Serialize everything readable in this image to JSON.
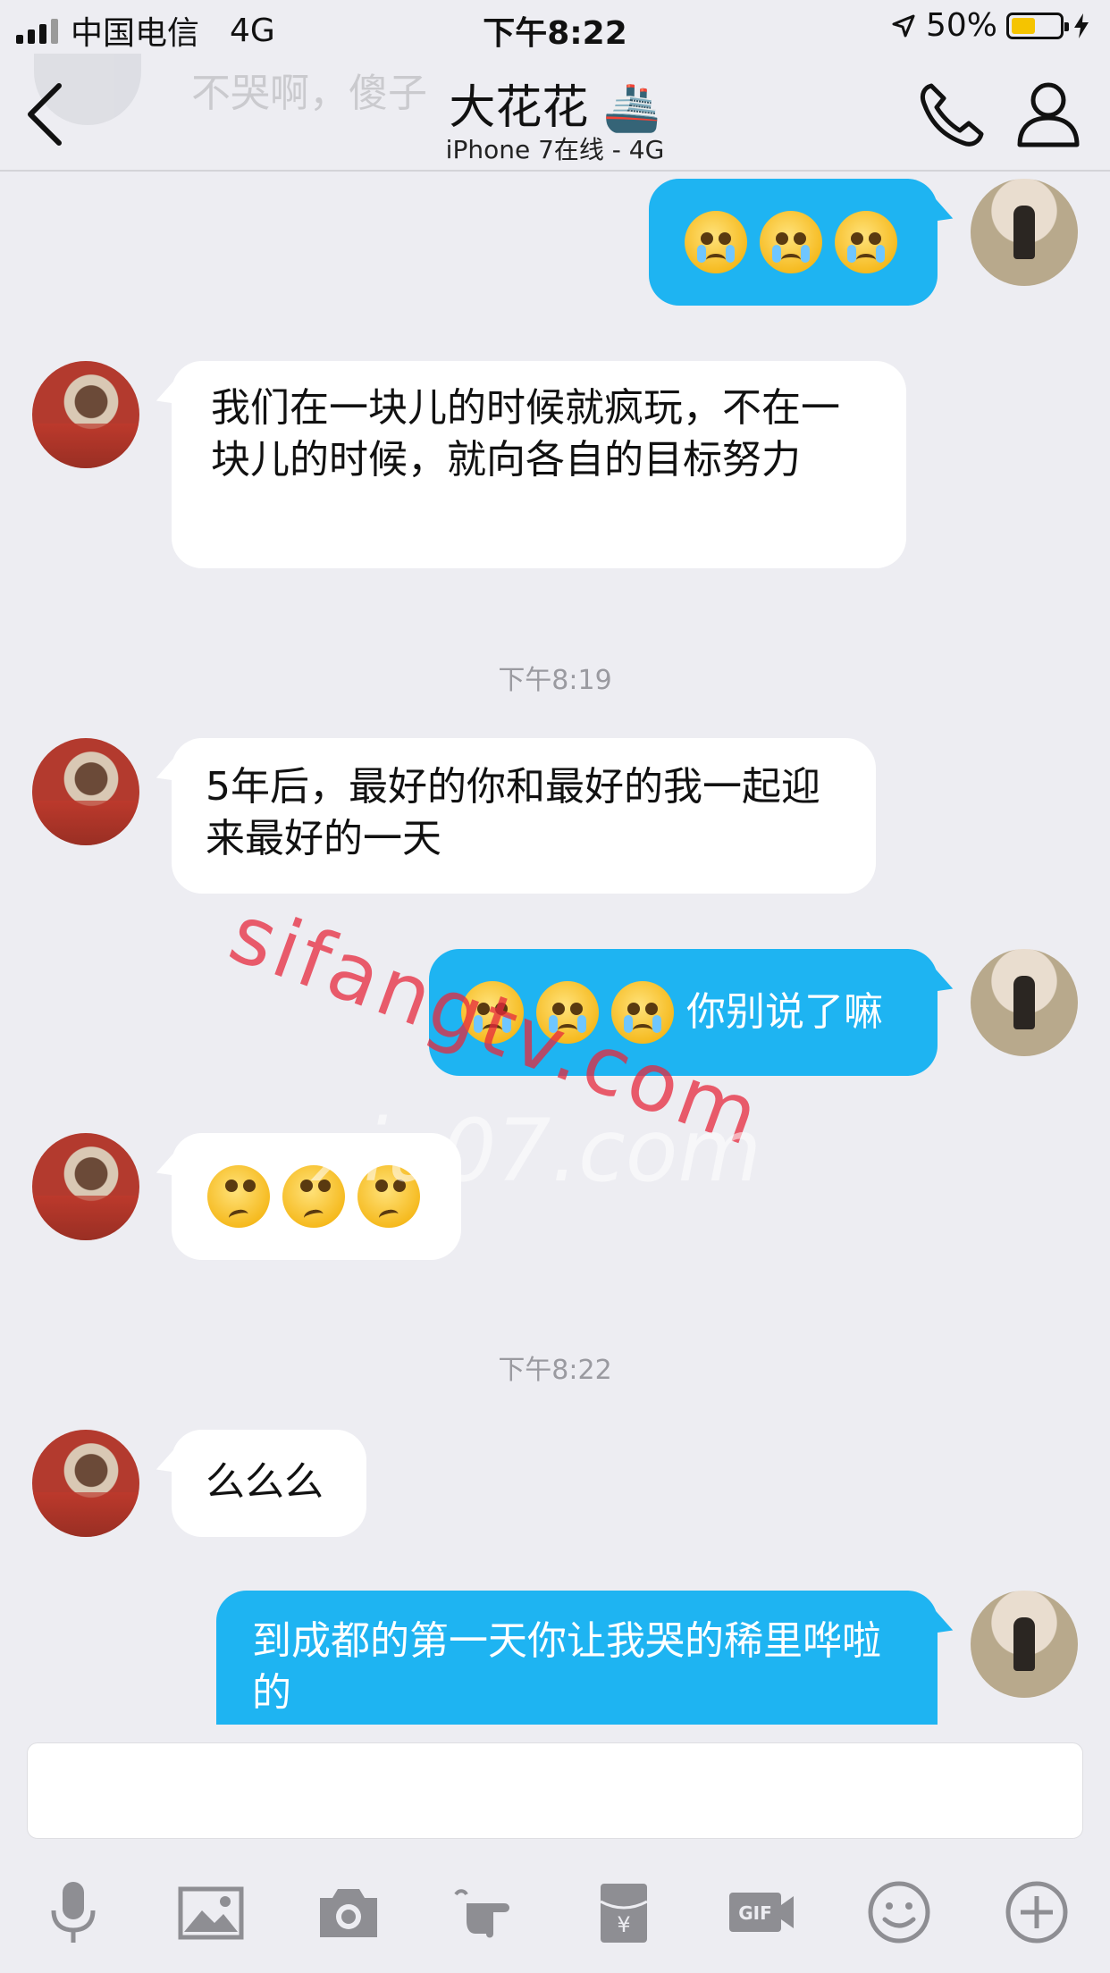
{
  "status_bar": {
    "carrier": "中国电信",
    "network": "4G",
    "time": "下午8:22",
    "battery": "50%",
    "battery_level": 0.5
  },
  "header": {
    "ghost_preview": "不哭啊，傻子",
    "title": "大花花 🚢",
    "subtitle": "iPhone 7在线 - 4G"
  },
  "messages": [
    {
      "sender": "me",
      "type": "emoji",
      "emoji": [
        "crying-face",
        "crying-face",
        "crying-face"
      ]
    },
    {
      "sender": "other",
      "type": "text",
      "text": "我们在一块儿的时候就疯玩，不在一块儿的时候，就向各自的目标努力"
    },
    {
      "sender": "system",
      "type": "timestamp",
      "text": "下午8:19"
    },
    {
      "sender": "other",
      "type": "text",
      "text": "5年后，最好的你和最好的我一起迎来最好的一天"
    },
    {
      "sender": "me",
      "type": "emoji-text",
      "emoji": [
        "crying-face",
        "crying-face",
        "crying-face"
      ],
      "text": "你别说了嘛"
    },
    {
      "sender": "other",
      "type": "emoji",
      "emoji": [
        "eye-roll-face",
        "eye-roll-face",
        "eye-roll-face"
      ]
    },
    {
      "sender": "system",
      "type": "timestamp",
      "text": "下午8:22"
    },
    {
      "sender": "other",
      "type": "text",
      "text": "么么么"
    },
    {
      "sender": "me",
      "type": "text",
      "text": "到成都的第一天你让我哭的稀里哗啦的"
    }
  ],
  "watermarks": [
    "sifangtv.com",
    "xiu07.com"
  ],
  "toolbar": [
    "microphone-icon",
    "image-icon",
    "camera-icon",
    "poke-icon",
    "red-packet-icon",
    "gif-icon",
    "emoji-icon",
    "plus-icon"
  ],
  "colors": {
    "outgoing_bubble": "#1eb4f2",
    "incoming_bubble": "#ffffff",
    "background": "#ededf2",
    "battery": "#f5c400",
    "timestamp": "#9a9aa0"
  }
}
